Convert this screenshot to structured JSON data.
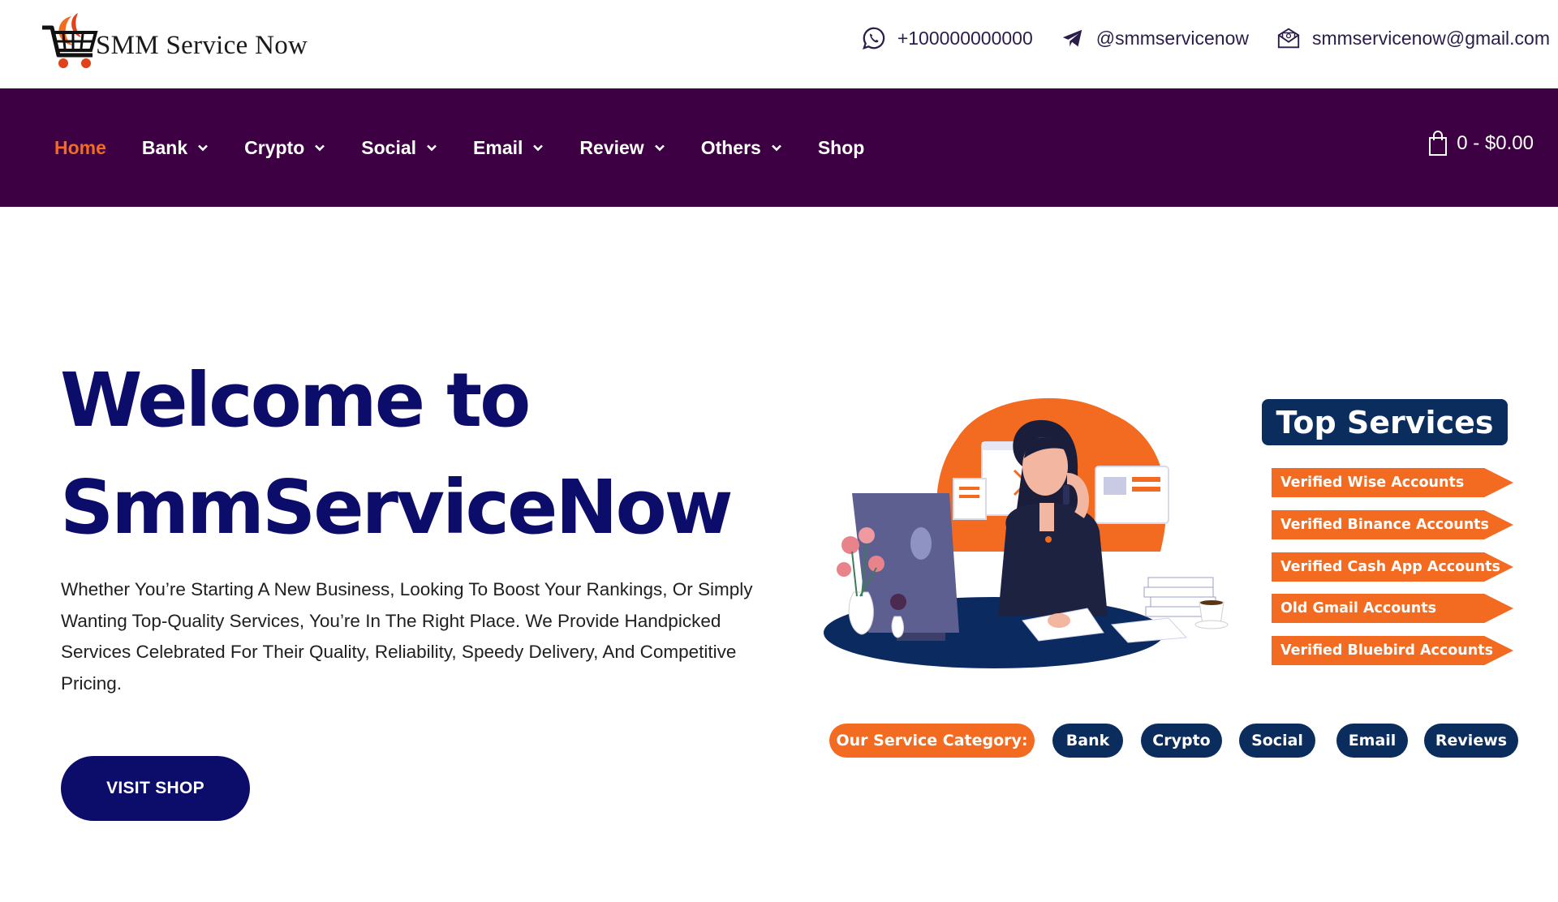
{
  "brand": {
    "logo_text": "SMM Service Now"
  },
  "contacts": {
    "phone": "+100000000000",
    "telegram": "@smmservicenow",
    "email": "smmservicenow@gmail.com"
  },
  "nav": {
    "items": [
      {
        "label": "Home",
        "active": true,
        "dropdown": false
      },
      {
        "label": "Bank",
        "active": false,
        "dropdown": true
      },
      {
        "label": "Crypto",
        "active": false,
        "dropdown": true
      },
      {
        "label": "Social",
        "active": false,
        "dropdown": true
      },
      {
        "label": "Email",
        "active": false,
        "dropdown": true
      },
      {
        "label": "Review",
        "active": false,
        "dropdown": true
      },
      {
        "label": "Others",
        "active": false,
        "dropdown": true
      },
      {
        "label": "Shop",
        "active": false,
        "dropdown": false
      }
    ],
    "cart_summary": "0 - $0.00"
  },
  "hero": {
    "title_line1": "Welcome to",
    "title_line2": "SmmServiceNow",
    "paragraph": "Whether You’re Starting A New Business, Looking To Boost Your Rankings, Or Simply Wanting Top-Quality Services, You’re In The Right Place. We Provide Handpicked Services Celebrated For Their Quality, Reliability, Speedy Delivery, And Competitive Pricing.",
    "button_label": "VISIT SHOP"
  },
  "top_services": {
    "title": "Top Services",
    "items": [
      "Verified Wise Accounts",
      "Verified Binance Accounts",
      "Verified Cash App Accounts",
      "Old Gmail Accounts",
      "Verified Bluebird Accounts"
    ]
  },
  "categories": {
    "label": "Our Service Category:",
    "items": [
      "Bank",
      "Crypto",
      "Social",
      "Email",
      "Reviews"
    ]
  },
  "colors": {
    "nav_bg": "#3d0042",
    "accent_orange": "#f36b21",
    "navy": "#0c0d6b",
    "badge_navy": "#0a2d5e"
  },
  "icons": [
    "whatsapp-icon",
    "telegram-icon",
    "email-icon",
    "shopping-bag-icon",
    "chevron-down-icon"
  ]
}
